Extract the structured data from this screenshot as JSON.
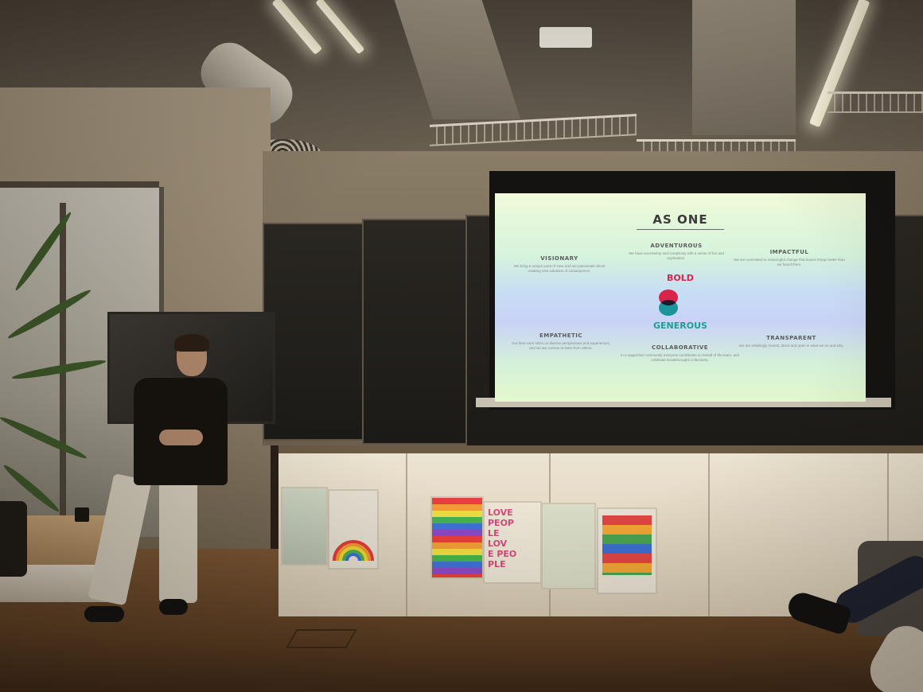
{
  "slide": {
    "title": "AS ONE",
    "center_top": "BOLD",
    "center_bottom": "GENEROUS",
    "values": [
      {
        "heading": "VISIONARY",
        "description": "We bring a unique point of view and are passionate about creating new solutions of consequence."
      },
      {
        "heading": "ADVENTUROUS",
        "description": "We have uncertainty and complexity with a sense of fun and exploration."
      },
      {
        "heading": "IMPACTFUL",
        "description": "We are committed to meaningful change that leaves things better than we found them."
      },
      {
        "heading": "EMPATHETIC",
        "description": "Our best work relies on diverse perspectives and experiences, and we are curious to learn from others."
      },
      {
        "heading": "COLLABORATIVE",
        "description": "In a supportive community everyone contributes on behalf of the team, and celebrate breakthroughs collectively."
      },
      {
        "heading": "TRANSPARENT",
        "description": "We are unfailingly honest, direct and open in what we do and why."
      }
    ],
    "colors": {
      "bold": "#d8234a",
      "generous": "#1e9e93"
    }
  },
  "posters": {
    "love_people": [
      "LOVE",
      "PEOP",
      "LE",
      "LOV",
      "E PEO",
      "PLE"
    ]
  }
}
